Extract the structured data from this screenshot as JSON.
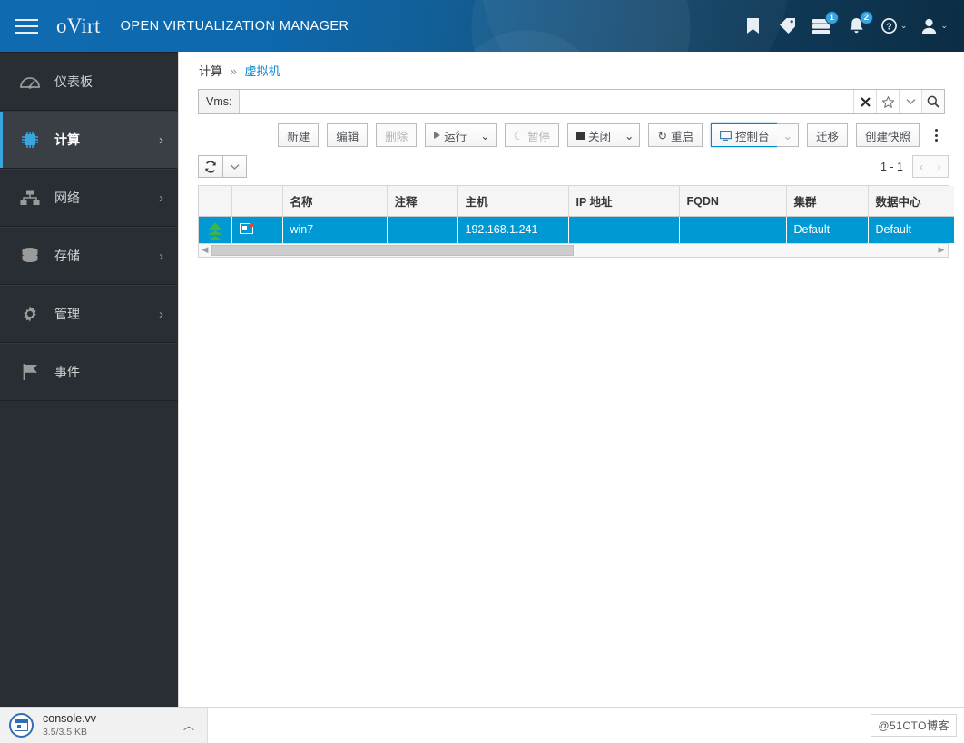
{
  "masthead": {
    "logo_text": "oVirt",
    "title": "OPEN VIRTUALIZATION MANAGER",
    "icons": [
      {
        "name": "bookmark-icon",
        "badge": ""
      },
      {
        "name": "tag-icon",
        "badge": ""
      },
      {
        "name": "tasks-icon",
        "badge": "1"
      },
      {
        "name": "bell-icon",
        "badge": "2"
      },
      {
        "name": "help-icon",
        "badge": ""
      },
      {
        "name": "user-icon",
        "badge": ""
      }
    ],
    "accent_color": "#39a5dc",
    "bg_left": "#0f6ab0",
    "bg_right": "#0c2d44"
  },
  "sidebar": {
    "items": [
      {
        "label": "仪表板",
        "icon": "dashboard-icon",
        "has_caret": false,
        "active": false
      },
      {
        "label": "计算",
        "icon": "compute-chip-icon",
        "has_caret": true,
        "active": true
      },
      {
        "label": "网络",
        "icon": "network-icon",
        "has_caret": true,
        "active": false
      },
      {
        "label": "存储",
        "icon": "storage-database-icon",
        "has_caret": true,
        "active": false
      },
      {
        "label": "管理",
        "icon": "gear-icon",
        "has_caret": true,
        "active": false
      },
      {
        "label": "事件",
        "icon": "flag-icon",
        "has_caret": false,
        "active": false
      }
    ],
    "caret_glyph": "›"
  },
  "breadcrumb": {
    "parent": "计算",
    "separator": "»",
    "current": "虚拟机"
  },
  "search": {
    "prefix_label": "Vms:",
    "value": "",
    "placeholder": "",
    "clear_glyph": "✖",
    "star_glyph": "☆",
    "caret_glyph": "⌄"
  },
  "toolbar": {
    "new_label": "新建",
    "edit_label": "编辑",
    "delete_label": "删除",
    "run_label": "运行",
    "suspend_label": "暂停",
    "shutdown_label": "关闭",
    "reboot_label": "重启",
    "console_label": "控制台",
    "migrate_label": "迁移",
    "snapshot_label": "创建快照",
    "caret_glyph": "⌄",
    "reboot_glyph": "↻",
    "suspend_glyph": "☾"
  },
  "grid_toolbar": {
    "refresh_glyph": "⟳",
    "caret_glyph": "⌄",
    "pagination_text": "1 - 1",
    "prev_glyph": "‹",
    "next_glyph": "›"
  },
  "table": {
    "columns": [
      "",
      "",
      "名称",
      "注释",
      "主机",
      "IP 地址",
      "FQDN",
      "集群",
      "数据中心"
    ],
    "rows": [
      {
        "status_icon": "vm-up-green-arrow-icon",
        "type_icon": "vm-console-screen-icon",
        "name": "win7",
        "comment": "",
        "host": "192.168.1.241",
        "ip_address": "",
        "fqdn": "",
        "cluster": "Default",
        "data_center": "Default",
        "selected": true
      }
    ],
    "selected_row_color": "#0099d3",
    "scroll_left_glyph": "◀",
    "scroll_right_glyph": "▶"
  },
  "download_bar": {
    "file_name": "console.vv",
    "file_size": "3.5/3.5 KB",
    "caret_glyph": "︿"
  },
  "watermark": {
    "text": "@51CTO博客"
  }
}
